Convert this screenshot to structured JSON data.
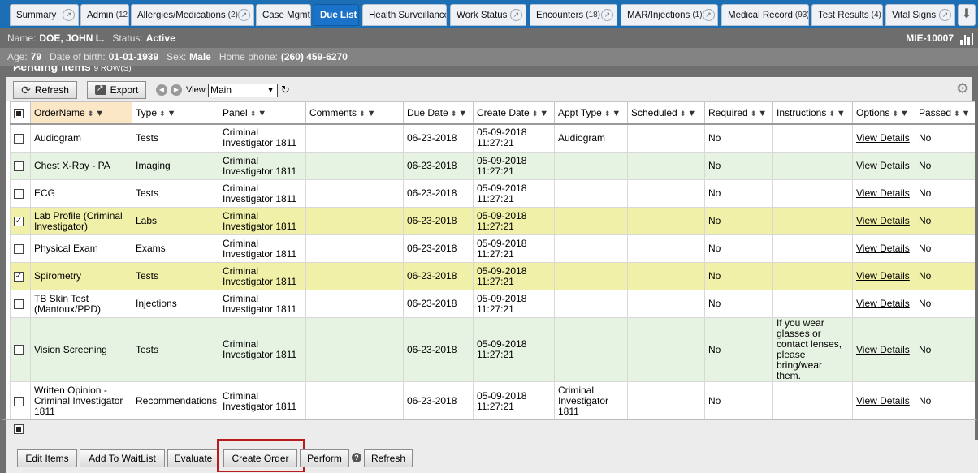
{
  "tabs": [
    {
      "label": "Summary",
      "count": "",
      "expand": true
    },
    {
      "label": "Admin",
      "count": "(12)",
      "expand": false
    },
    {
      "label": "Allergies/Medications",
      "count": "(2)",
      "expand": true
    },
    {
      "label": "Case Mgmt",
      "count": "",
      "expand": false
    },
    {
      "label": "Due List",
      "count": "",
      "expand": false,
      "active": true
    },
    {
      "label": "Health Surveillance",
      "count": "",
      "expand": false
    },
    {
      "label": "Work Status",
      "count": "",
      "expand": true
    },
    {
      "label": "Encounters",
      "count": "(18)",
      "expand": true
    },
    {
      "label": "MAR/Injections",
      "count": "(1)",
      "expand": true
    },
    {
      "label": "Medical Record",
      "count": "(93)",
      "expand": false
    },
    {
      "label": "Test Results",
      "count": "(4)",
      "expand": false
    },
    {
      "label": "Vital Signs",
      "count": "",
      "expand": true
    }
  ],
  "patient": {
    "name_label": "Name:",
    "name": "DOE, JOHN L.",
    "status_label": "Status:",
    "status": "Active",
    "mrn": "MIE-10007",
    "age_label": "Age:",
    "age": "79",
    "dob_label": "Date of birth:",
    "dob": "01-01-1939",
    "sex_label": "Sex:",
    "sex": "Male",
    "phone_label": "Home phone:",
    "phone": "(260) 459-6270"
  },
  "panel": {
    "title": "Pending Items",
    "subtitle": "9 ROW(S)"
  },
  "toolbar": {
    "refresh": "Refresh",
    "export": "Export",
    "view_label": "View:",
    "view_value": "Main"
  },
  "columns": [
    "OrderName",
    "Type",
    "Panel",
    "Comments",
    "Due Date",
    "Create Date",
    "Appt Type",
    "Scheduled",
    "Required",
    "Instructions",
    "Options",
    "Passed"
  ],
  "rows": [
    {
      "checked": false,
      "style": "",
      "name": "Audiogram",
      "type": "Tests",
      "panel": "Criminal Investigator 1811",
      "comments": "",
      "due": "06-23-2018",
      "created": "05-09-2018 11:27:21",
      "appt": "Audiogram",
      "scheduled": "",
      "required": "No",
      "instructions": "",
      "options": "View Details",
      "passed": "No"
    },
    {
      "checked": false,
      "style": "alt",
      "name": "Chest X-Ray - PA",
      "type": "Imaging",
      "panel": "Criminal Investigator 1811",
      "comments": "",
      "due": "06-23-2018",
      "created": "05-09-2018 11:27:21",
      "appt": "",
      "scheduled": "",
      "required": "No",
      "instructions": "",
      "options": "View Details",
      "passed": "No"
    },
    {
      "checked": false,
      "style": "",
      "name": "ECG",
      "type": "Tests",
      "panel": "Criminal Investigator 1811",
      "comments": "",
      "due": "06-23-2018",
      "created": "05-09-2018 11:27:21",
      "appt": "",
      "scheduled": "",
      "required": "No",
      "instructions": "",
      "options": "View Details",
      "passed": "No"
    },
    {
      "checked": true,
      "style": "sel",
      "name": "Lab Profile (Criminal Investigator)",
      "type": "Labs",
      "panel": "Criminal Investigator 1811",
      "comments": "",
      "due": "06-23-2018",
      "created": "05-09-2018 11:27:21",
      "appt": "",
      "scheduled": "",
      "required": "No",
      "instructions": "",
      "options": "View Details",
      "passed": "No"
    },
    {
      "checked": false,
      "style": "",
      "name": "Physical Exam",
      "type": "Exams",
      "panel": "Criminal Investigator 1811",
      "comments": "",
      "due": "06-23-2018",
      "created": "05-09-2018 11:27:21",
      "appt": "",
      "scheduled": "",
      "required": "No",
      "instructions": "",
      "options": "View Details",
      "passed": "No"
    },
    {
      "checked": true,
      "style": "sel",
      "name": "Spirometry",
      "type": "Tests",
      "panel": "Criminal Investigator 1811",
      "comments": "",
      "due": "06-23-2018",
      "created": "05-09-2018 11:27:21",
      "appt": "",
      "scheduled": "",
      "required": "No",
      "instructions": "",
      "options": "View Details",
      "passed": "No"
    },
    {
      "checked": false,
      "style": "",
      "name": "TB Skin Test (Mantoux/PPD)",
      "type": "Injections",
      "panel": "Criminal Investigator 1811",
      "comments": "",
      "due": "06-23-2018",
      "created": "05-09-2018 11:27:21",
      "appt": "",
      "scheduled": "",
      "required": "No",
      "instructions": "",
      "options": "View Details",
      "passed": "No"
    },
    {
      "checked": false,
      "style": "alt",
      "name": "Vision Screening",
      "type": "Tests",
      "panel": "Criminal Investigator 1811",
      "comments": "",
      "due": "06-23-2018",
      "created": "05-09-2018 11:27:21",
      "appt": "",
      "scheduled": "",
      "required": "No",
      "instructions": "If you wear glasses or contact lenses, please bring/wear them.",
      "options": "View Details",
      "passed": "No"
    },
    {
      "checked": false,
      "style": "",
      "name": "Written Opinion - Criminal Investigator 1811",
      "type": "Recommendations",
      "panel": "Criminal Investigator 1811",
      "comments": "",
      "due": "06-23-2018",
      "created": "05-09-2018 11:27:21",
      "appt": "Criminal Investigator 1811",
      "scheduled": "",
      "required": "No",
      "instructions": "",
      "options": "View Details",
      "passed": "No"
    }
  ],
  "actions": {
    "edit_items": "Edit Items",
    "add_to_waitlist": "Add To WaitList",
    "evaluate": "Evaluate",
    "create_order": "Create Order",
    "perform": "Perform",
    "help": "?",
    "refresh": "Refresh"
  }
}
